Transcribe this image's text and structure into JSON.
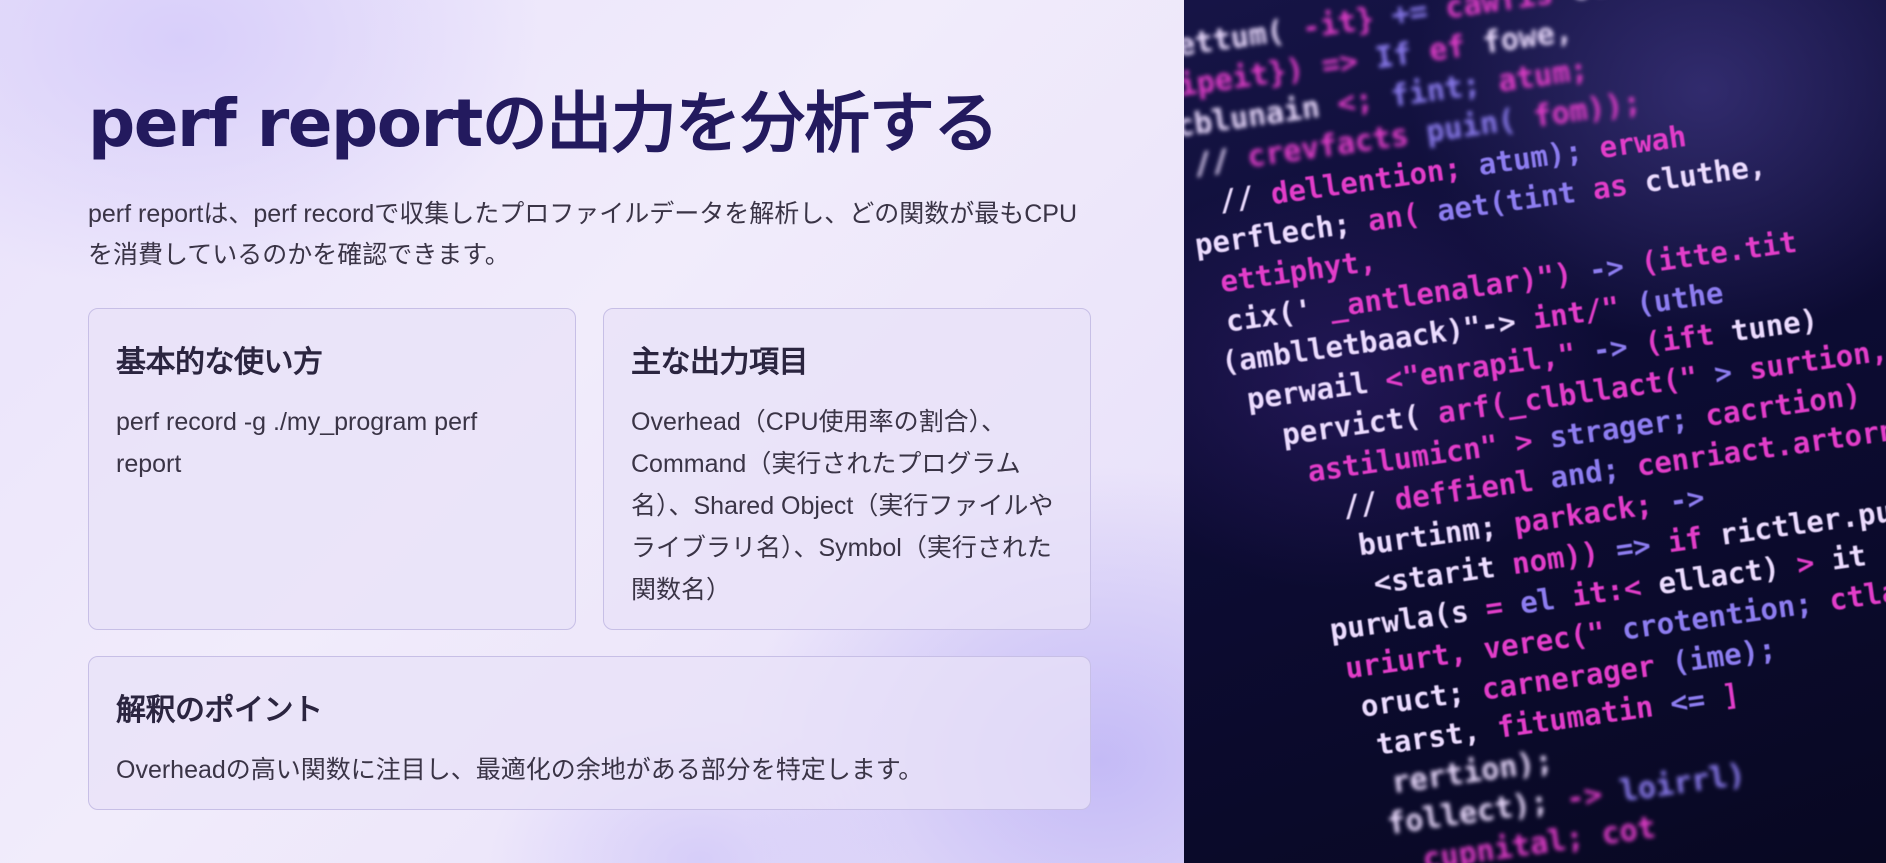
{
  "title": "perf reportの出力を分析する",
  "intro": "perf reportは、perf recordで収集したプロファイルデータを解析し、どの関数が最もCPUを消費しているのかを確認できます。",
  "cards": {
    "usage": {
      "heading": "基本的な使い方",
      "body": "perf record -g ./my_program perf report"
    },
    "output": {
      "heading": "主な出力項目",
      "body": "Overhead（CPU使用率の割合）、Command（実行されたプログラム名）、Shared Object（実行ファイルやライブラリ名）、Symbol（実行された関数名）"
    },
    "interpret": {
      "heading": "解釈のポイント",
      "body": "Overheadの高い関数に注目し、最適化の余地がある部分を特定します。"
    }
  },
  "image": {
    "code_lines": [
      "ettum( -it} += cawfis clon)",
      "(cipeit}) => If ef fowe,",
      "ecblunain <; fint; atum;",
      "// crevfacts puin( fom));",
      "// dellention; atum); erwah",
      "perflech; an( aet(tint as cluthe,",
      "ettiphyt,",
      "cix(' _antlenalar)\") -> (itte.tit",
      "(amblletbaack)\"-> int/\" (uthe",
      "perwail <\"enrapil,\" -> (ift tune)",
      "pervict( arf(_clbllact(\" > surtion,",
      "astilumicn\" > strager; cacrtion)",
      "// deffienl and; cenriact.artornens",
      "burtinm; parkack; ->",
      "<starit nom)) => if rictler.puor",
      "purwla(s = el it:< ellact) > it",
      "uriurt, verec(\" crotention; ctlant)",
      "oruct; carnerager (ime);",
      "tarst, fitumatin <= ]",
      "rertion);",
      "follect); -> loirrl)",
      "cupnital; cot"
    ],
    "colors": {
      "keyword": "#e23cc9",
      "identifier": "#ecdcff",
      "muted": "#8d7df0",
      "accent": "#5a6dff"
    }
  }
}
